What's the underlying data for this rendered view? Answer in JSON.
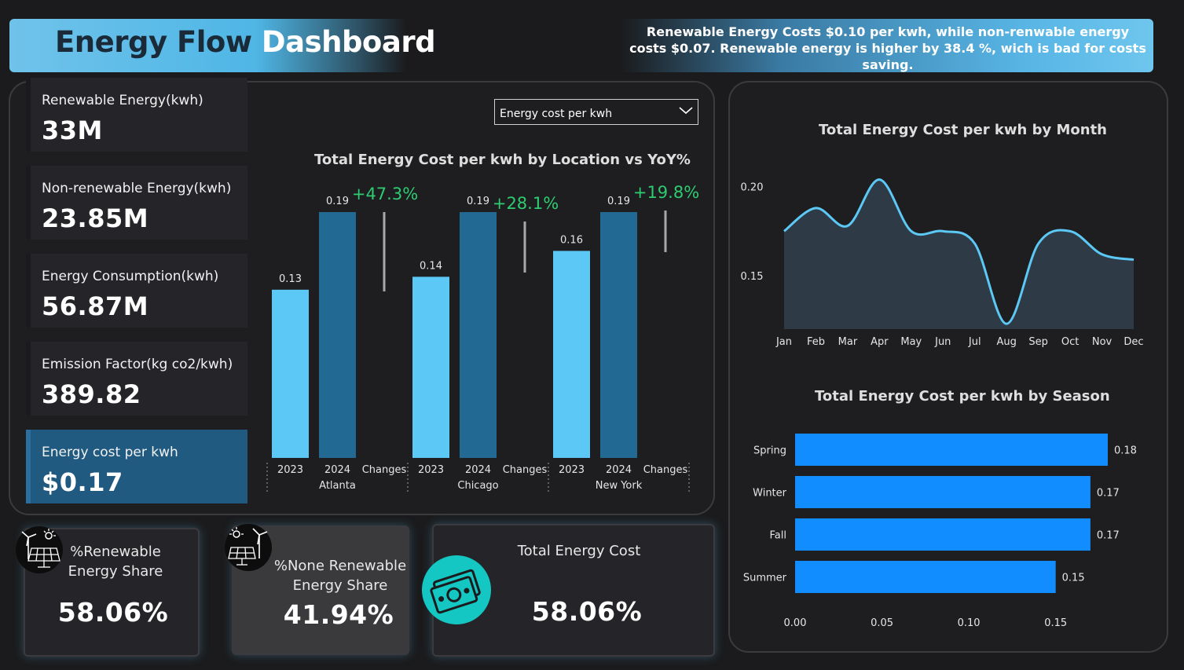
{
  "header": {
    "title_part1": "Energy Flow",
    "title_part2": "Dashboard",
    "insight": "Renewable Energy Costs $0.10 per kwh, while non-renwable energy costs $0.07. Renewable energy is higher by 38.4 %, wich is bad for costs saving."
  },
  "kpis": [
    {
      "label": "Renewable Energy(kwh)",
      "value": "33M"
    },
    {
      "label": "Non-renewable Energy(kwh)",
      "value": "23.85M"
    },
    {
      "label": "Energy Consumption(kwh)",
      "value": "56.87M"
    },
    {
      "label": "Emission Factor(kg co2/kwh)",
      "value": "389.82"
    },
    {
      "label": "Energy cost per kwh",
      "value": "$0.17"
    }
  ],
  "dropdown": {
    "selected": "Energy cost per kwh"
  },
  "cards": {
    "renewable_share": {
      "label": "%Renewable Energy Share",
      "value": "58.06%"
    },
    "nonrenewable_share": {
      "label": "%None Renewable Energy Share",
      "value": "41.94%"
    },
    "total_cost": {
      "label": "Total Energy Cost",
      "value": "58.06%"
    }
  },
  "colors": {
    "bar_2023": "#5bc8f5",
    "bar_2024": "#226a94",
    "yoy_text": "#2ecc71",
    "season_bar": "#118dff",
    "area_line": "#5bc8f5",
    "area_fill": "#2e3b46",
    "money_icon_bg": "#14c7c3"
  },
  "chart_data": [
    {
      "type": "bar",
      "title": "Total Energy Cost per kwh by Location vs YoY%",
      "groups": [
        {
          "location": "Atlanta",
          "categories": [
            "2023",
            "2024",
            "Changes"
          ],
          "values": [
            0.13,
            0.19
          ],
          "labels": [
            "0.13",
            "0.19"
          ],
          "yoy": "+47.3%"
        },
        {
          "location": "Chicago",
          "categories": [
            "2023",
            "2024",
            "Changes"
          ],
          "values": [
            0.14,
            0.19
          ],
          "labels": [
            "0.14",
            "0.19"
          ],
          "yoy": "+28.1%"
        },
        {
          "location": "New York",
          "categories": [
            "2023",
            "2024",
            "Changes"
          ],
          "values": [
            0.16,
            0.19
          ],
          "labels": [
            "0.16",
            "0.19"
          ],
          "yoy": "+19.8%"
        }
      ],
      "ylim": [
        0,
        0.19
      ]
    },
    {
      "type": "area",
      "title": "Total Energy Cost per kwh by Month",
      "x": [
        "Jan",
        "Feb",
        "Mar",
        "Apr",
        "May",
        "Jun",
        "Jul",
        "Aug",
        "Sep",
        "Oct",
        "Nov",
        "Dec"
      ],
      "values": [
        0.175,
        0.188,
        0.178,
        0.204,
        0.175,
        0.175,
        0.168,
        0.123,
        0.168,
        0.175,
        0.162,
        0.159
      ],
      "yticks": [
        "0.20",
        "0.15"
      ],
      "ylim": [
        0.12,
        0.21
      ]
    },
    {
      "type": "bar",
      "orientation": "horizontal",
      "title": "Total Energy Cost per kwh by Season",
      "categories": [
        "Spring",
        "Winter",
        "Fall",
        "Summer"
      ],
      "values": [
        0.18,
        0.17,
        0.17,
        0.15
      ],
      "labels": [
        "0.18",
        "0.17",
        "0.17",
        "0.15"
      ],
      "xticks": [
        "0.00",
        "0.05",
        "0.10",
        "0.15"
      ],
      "xlim": [
        0,
        0.18
      ]
    }
  ]
}
